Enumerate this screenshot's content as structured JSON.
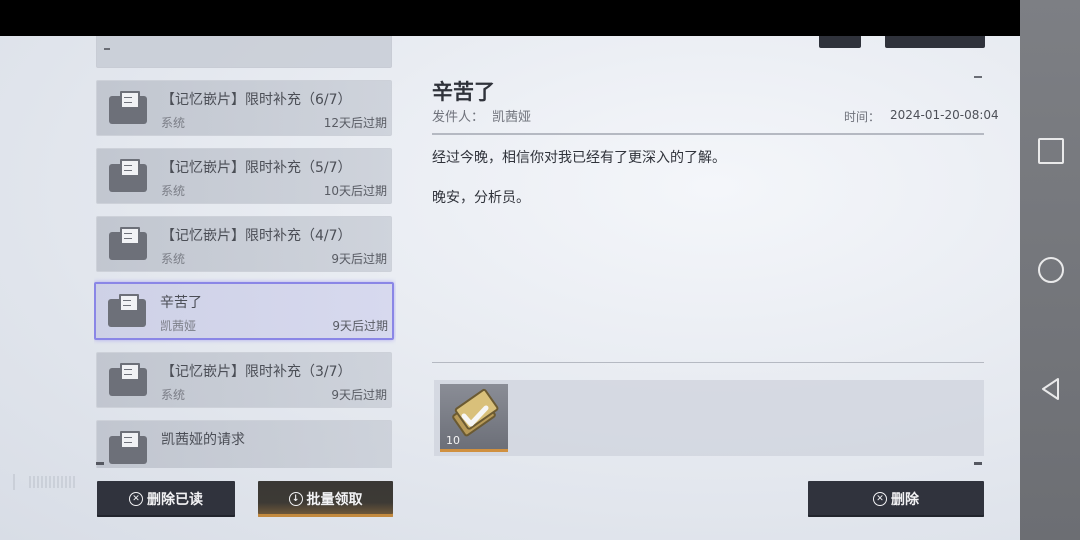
{
  "mail_list": {
    "items": [
      {
        "title": "【记忆嵌片】限时补充（6/7）",
        "sender": "系统",
        "expire": "12天后过期"
      },
      {
        "title": "【记忆嵌片】限时补充（5/7）",
        "sender": "系统",
        "expire": "10天后过期"
      },
      {
        "title": "【记忆嵌片】限时补充（4/7）",
        "sender": "系统",
        "expire": "9天后过期"
      },
      {
        "title": "辛苦了",
        "sender": "凯茜娅",
        "expire": "9天后过期"
      },
      {
        "title": "【记忆嵌片】限时补充（3/7）",
        "sender": "系统",
        "expire": "9天后过期"
      },
      {
        "title": "凯茜娅的请求",
        "sender": "",
        "expire": ""
      }
    ],
    "selected_index": 3
  },
  "buttons": {
    "delete_read": "删除已读",
    "collect_all": "批量领取",
    "delete": "删除"
  },
  "detail": {
    "title": "辛苦了",
    "sender_label": "发件人：",
    "sender": "凯茜娅",
    "time_label": "时间：",
    "time": "2024-01-20-08:04",
    "body": [
      "经过今晚，相信你对我已经有了更深入的了解。",
      "晚安，分析员。"
    ],
    "attachment": {
      "icon": "memory-chip-icon",
      "count": "10"
    }
  },
  "colors": {
    "accent_selected": "#8a86e6",
    "button_dark": "#30333d",
    "button_gold_accent": "#c38a3f"
  }
}
